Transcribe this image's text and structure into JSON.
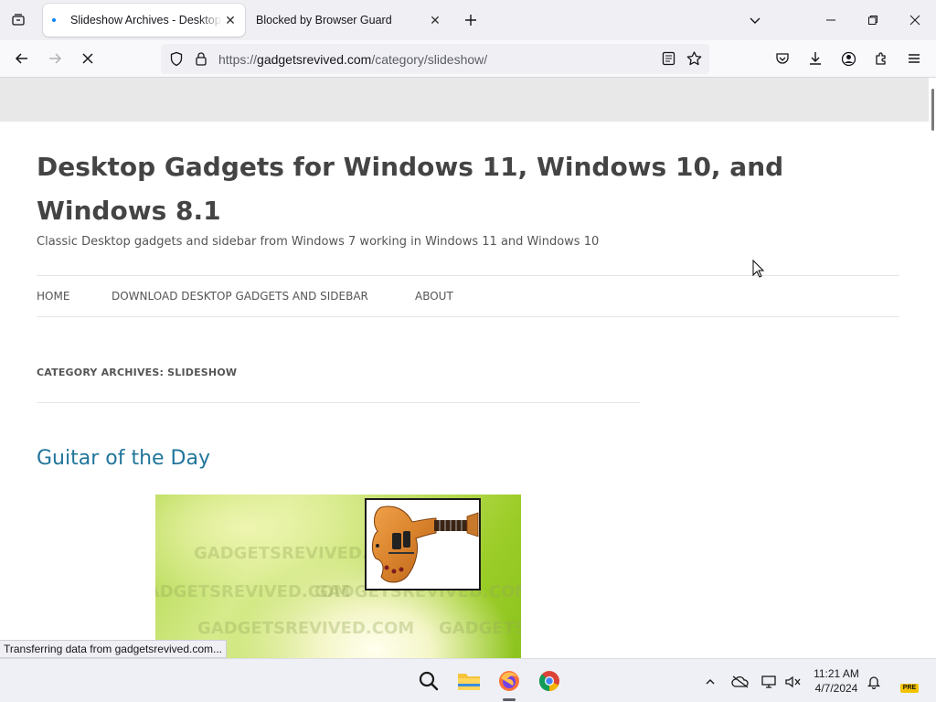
{
  "browser": {
    "tabs": [
      {
        "title": "Slideshow Archives - Desktop G",
        "active": true,
        "loading": true
      },
      {
        "title": "Blocked by Browser Guard",
        "active": false
      }
    ],
    "url_scheme": "https://",
    "url_host": "gadgetsrevived.com",
    "url_path": "/category/slideshow/",
    "status_text": "Transferring data from gadgetsrevived.com..."
  },
  "page": {
    "site_title": "Desktop Gadgets for Windows 11, Windows 10, and Windows 8.1",
    "site_description": "Classic Desktop gadgets and sidebar from Windows 7 working in Windows 11 and Windows 10",
    "menu": [
      {
        "label": "HOME"
      },
      {
        "label": "DOWNLOAD DESKTOP GADGETS AND SIDEBAR"
      },
      {
        "label": "ABOUT"
      }
    ],
    "archive_title": "CATEGORY ARCHIVES: SLIDESHOW",
    "post_title": "Guitar of the Day",
    "watermark": "GADGETSREVIVED.COM"
  },
  "taskbar": {
    "time": "11:21 AM",
    "date": "4/7/2024",
    "badge": "PRE"
  },
  "colors": {
    "link": "#21759b",
    "title": "#444444"
  },
  "icons": [
    "tab-list-icon",
    "close-icon",
    "new-tab-icon",
    "list-all-tabs-icon",
    "minimize-icon",
    "restore-icon",
    "back-icon",
    "forward-icon",
    "loading-icon",
    "shield-icon",
    "lock-icon",
    "reader-view-icon",
    "bookmark-star-icon",
    "pocket-icon",
    "download-icon",
    "account-icon",
    "extensions-icon",
    "menu-icon",
    "search-icon",
    "file-explorer-icon",
    "firefox-icon",
    "chrome-icon",
    "chevron-up-icon",
    "onedrive-icon",
    "network-icon",
    "volume-icon",
    "bell-icon"
  ]
}
